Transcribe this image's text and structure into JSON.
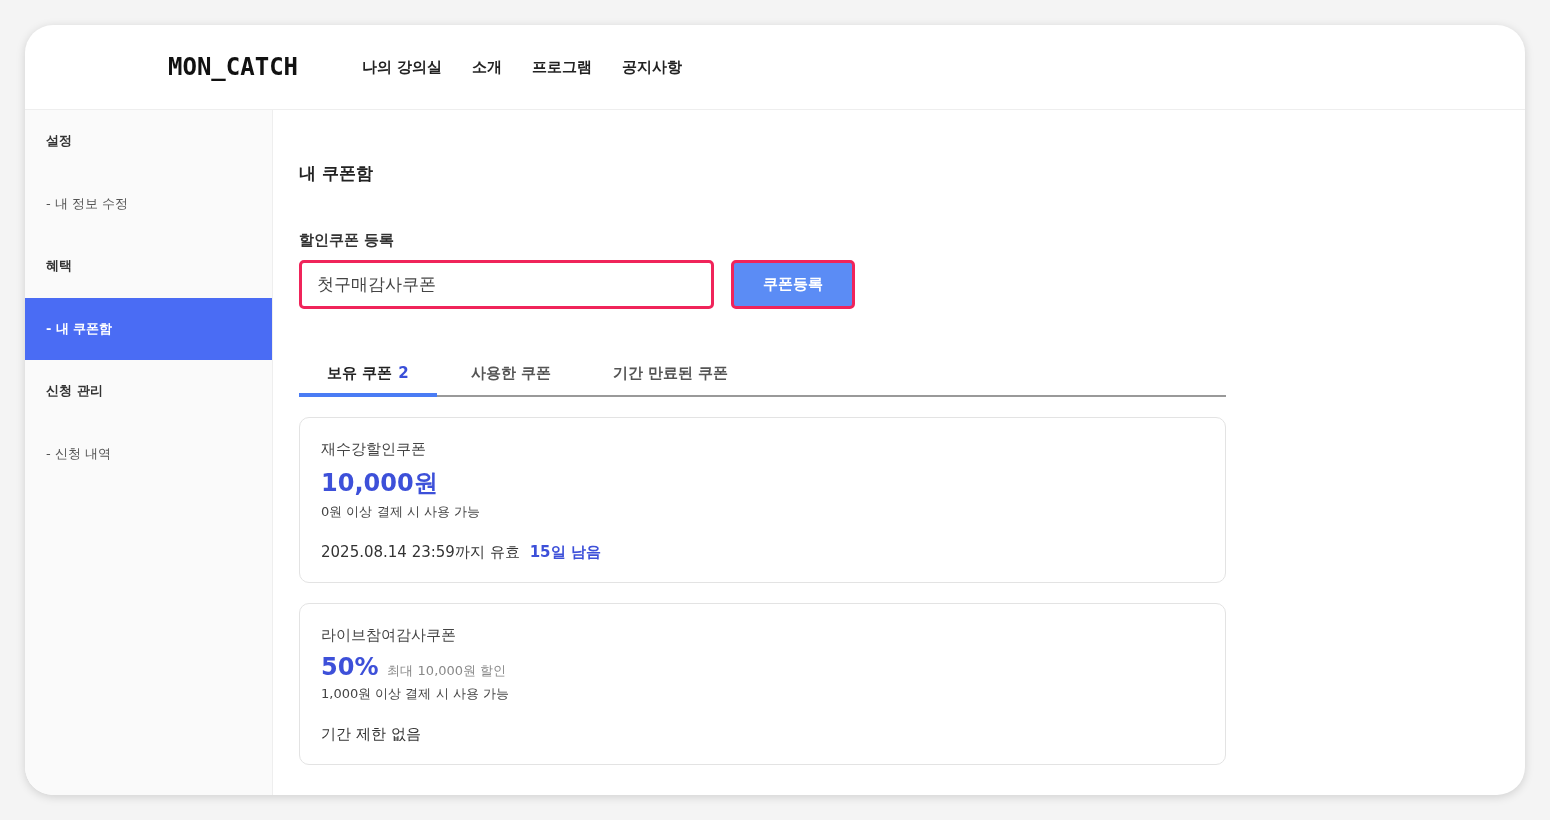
{
  "header": {
    "logo": "MON_CATCH",
    "nav": [
      "나의 강의실",
      "소개",
      "프로그램",
      "공지사항"
    ]
  },
  "sidebar": {
    "items": [
      {
        "label": "설정",
        "kind": "heading",
        "selected": false
      },
      {
        "label": "- 내 정보 수정",
        "kind": "link",
        "selected": false
      },
      {
        "label": "혜택",
        "kind": "heading",
        "selected": false
      },
      {
        "label": "- 내 쿠폰함",
        "kind": "link",
        "selected": true
      },
      {
        "label": "신청 관리",
        "kind": "heading",
        "selected": false
      },
      {
        "label": "- 신청 내역",
        "kind": "link",
        "selected": false
      }
    ]
  },
  "page_title": "내 쿠폰함",
  "register": {
    "label": "할인쿠폰 등록",
    "value": "첫구매감사쿠폰",
    "button": "쿠폰등록"
  },
  "tabs": [
    {
      "label": "보유 쿠폰",
      "count": "2",
      "selected": true
    },
    {
      "label": "사용한 쿠폰",
      "selected": false
    },
    {
      "label": "기간 만료된 쿠폰",
      "selected": false
    }
  ],
  "coupons": [
    {
      "name": "재수강할인쿠폰",
      "amount": "10,000원",
      "condition": "0원 이상 결제 시 사용 가능",
      "validity": "2025.08.14 23:59까지 유효",
      "remaining": "15일 남음"
    },
    {
      "name": "라이브참여감사쿠폰",
      "amount": "50%",
      "max_discount": "최대 10,000원 할인",
      "condition": "1,000원 이상 결제 시 사용 가능",
      "validity": "기간 제한 없음"
    }
  ]
}
